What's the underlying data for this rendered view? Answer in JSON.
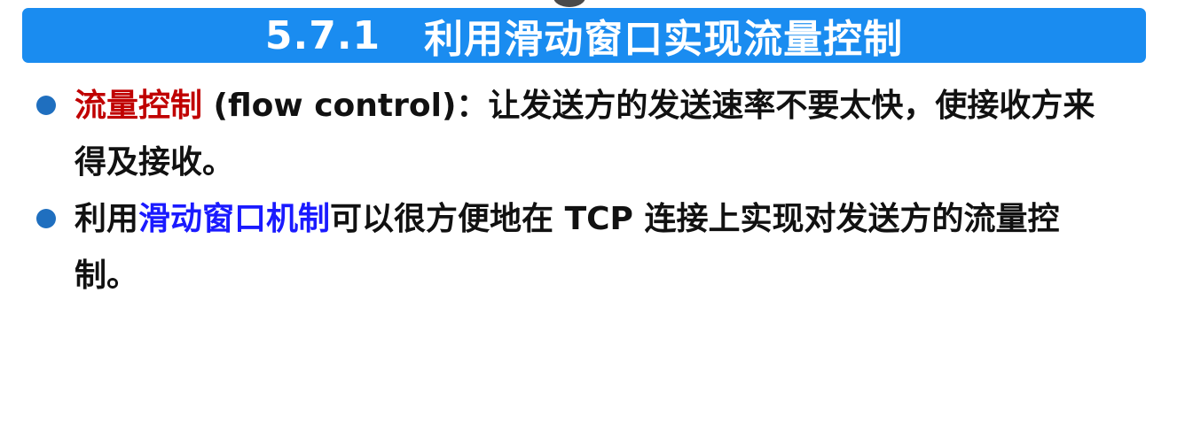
{
  "title": {
    "number": "5.7.1",
    "text": "利用滑动窗口实现流量控制"
  },
  "bullets": [
    {
      "highlight": "流量控制",
      "text": " (flow control)：让发送方的发送速率不要太快，使接收方来得及接收。"
    },
    {
      "prefix": "利用",
      "highlight": "滑动窗口机制",
      "text": "可以很方便地在 TCP 连接上实现对发送方的流量控制。"
    }
  ],
  "colors": {
    "title_bg": "#1a8cf0",
    "title_text": "#ffffff",
    "highlight_red": "#c00000",
    "highlight_blue": "#1a1aff",
    "bullet": "#1f6fbf"
  }
}
